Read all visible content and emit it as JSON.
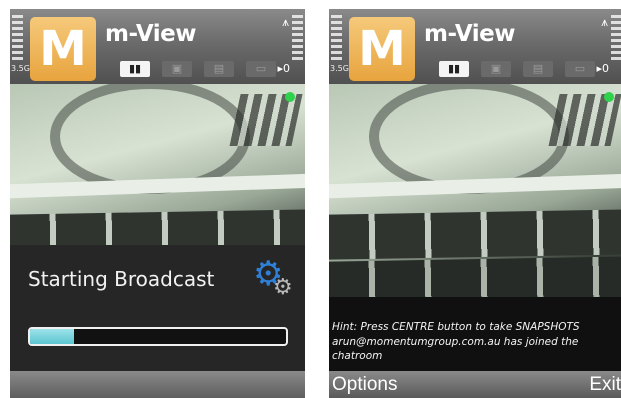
{
  "header": {
    "app_title": "m-View",
    "logo_letter": "M",
    "signal_label": "3.5G",
    "right_indicator": "0",
    "icons": [
      "signal-bars-icon",
      "battery-bars-icon",
      "antenna-icon",
      "video-mode-icon",
      "snapshot-mode-icon",
      "chat-mode-icon",
      "settings-mode-icon"
    ]
  },
  "left_screen": {
    "broadcast_text": "Starting Broadcast",
    "progress": 0.17,
    "icons": [
      "gear-icon"
    ]
  },
  "right_screen": {
    "hint_lines": [
      "Hint: Press CENTRE button to take SNAPSHOTS",
      "arun@momentumgroup.com.au has joined the",
      "chatroom"
    ],
    "softkeys": {
      "left": "Options",
      "right": "Exit"
    }
  },
  "colors": {
    "logo_orange": "#e8a43e",
    "progress_cyan": "#5cc5d0",
    "status_led_green": "#2fd24b",
    "gear_blue": "#2e7fd6"
  }
}
